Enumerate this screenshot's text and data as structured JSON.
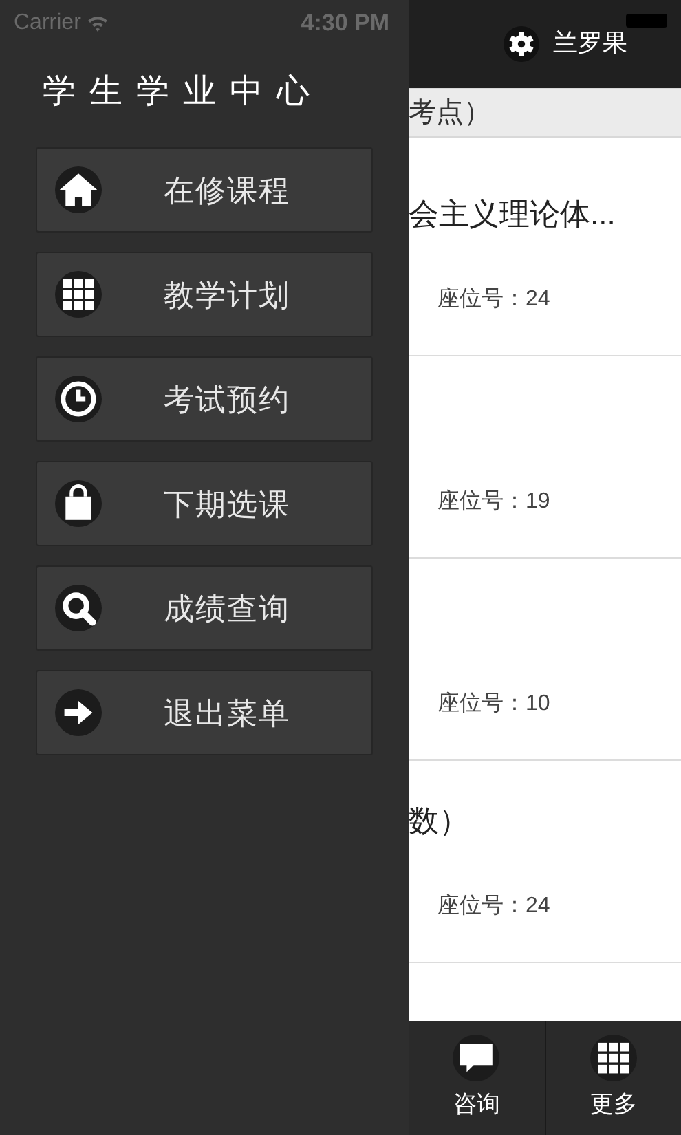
{
  "status_bar": {
    "carrier": "Carrier",
    "time": "4:30 PM"
  },
  "drawer": {
    "title": "学生学业中心",
    "items": [
      {
        "label": "在修课程"
      },
      {
        "label": "教学计划"
      },
      {
        "label": "考试预约"
      },
      {
        "label": "下期选课"
      },
      {
        "label": "成绩查询"
      },
      {
        "label": "退出菜单"
      }
    ]
  },
  "header": {
    "user": "兰罗果"
  },
  "section_header": "考点）",
  "exams": [
    {
      "title": "会主义理论体...",
      "seat": "座位号：24"
    },
    {
      "seat": "座位号：19"
    },
    {
      "seat": "座位号：10"
    },
    {
      "title": "数）",
      "seat": "座位号：24"
    }
  ],
  "tab_bar": [
    {
      "label": "咨询"
    },
    {
      "label": "更多"
    }
  ]
}
